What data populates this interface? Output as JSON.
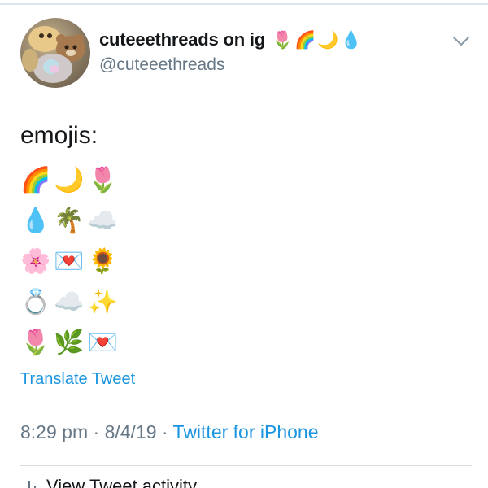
{
  "tweet": {
    "author": {
      "display_name": "cuteeethreads on ig",
      "name_emojis": "🌷🌈🌙💧",
      "handle": "@cuteeethreads",
      "avatar_icon": "avatar-plush-toys"
    },
    "more_icon": "chevron-down-icon",
    "text_heading": "emojis:",
    "emoji_lines": [
      "🌈🌙🌷",
      "💧🌴☁️",
      "🌸💌🌻",
      "💍☁️✨",
      "🌷🌿💌"
    ],
    "translate_label": "Translate Tweet",
    "meta": {
      "time": "8:29 pm",
      "separator": " · ",
      "date": "8/4/19",
      "source": "Twitter for iPhone"
    },
    "activity_label": "View Tweet activity",
    "activity_icon": "bar-chart-icon"
  },
  "colors": {
    "link": "#1b95e0",
    "secondary_text": "#657786",
    "primary_text": "#14171a"
  }
}
